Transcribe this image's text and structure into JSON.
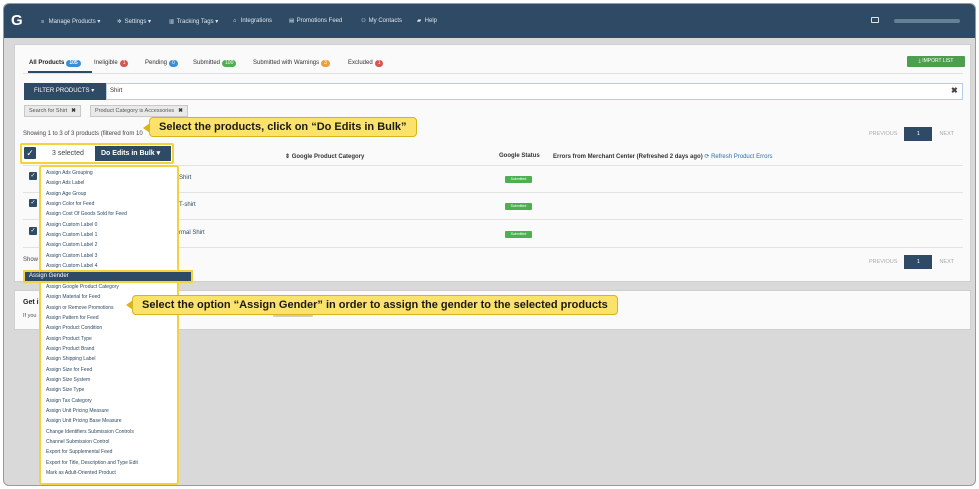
{
  "navbar": {
    "logo": "G",
    "items": [
      {
        "label": "Manage Products ▾",
        "icon": "list-icon"
      },
      {
        "label": "Settings ▾",
        "icon": "gear-icon"
      },
      {
        "label": "Tracking Tags ▾",
        "icon": "chart-icon"
      },
      {
        "label": "Integrations",
        "icon": "plug-icon"
      },
      {
        "label": "Promotions Feed",
        "icon": "feed-icon"
      },
      {
        "label": "My Contacts",
        "icon": "contacts-icon"
      },
      {
        "label": "Help",
        "icon": "help-icon"
      }
    ]
  },
  "tabs": [
    {
      "label": "All Products",
      "count": "105",
      "color": "#3a8fd9"
    },
    {
      "label": "Ineligible",
      "count": "1",
      "color": "#d9534f"
    },
    {
      "label": "Pending",
      "count": "0",
      "color": "#3a8fd9"
    },
    {
      "label": "Submitted",
      "count": "100",
      "color": "#4caf50"
    },
    {
      "label": "Submitted with Warnings",
      "count": "3",
      "color": "#e9a23b"
    },
    {
      "label": "Excluded",
      "count": "1",
      "color": "#d9534f"
    }
  ],
  "import_label": "IMPORT LIST",
  "filter": {
    "button_label": "FILTER PRODUCTS ▾",
    "search_value": "Shirt",
    "clear_symbol": "✖",
    "chips": [
      "Search for Shirt",
      "Product Category is Accessories"
    ]
  },
  "showing_text": "Showing 1 to 3 of 3 products (filtered from 10",
  "showing_bottom": "Show",
  "pager": {
    "previous": "PREVIOUS",
    "page": "1",
    "next": "NEXT"
  },
  "bulk": {
    "selected": "3 selected",
    "button": "Do Edits in Bulk ▾"
  },
  "table": {
    "headers": [
      "Google Product Category",
      "Google Status",
      "Errors from Merchant Center (Refreshed 2 days ago)"
    ],
    "refresh_link": "⟳ Refresh Product Errors",
    "rows": [
      {
        "title": "Shirt",
        "status": "Submitted"
      },
      {
        "title": "T-shirt",
        "status": "Submitted"
      },
      {
        "title": "rmal Shirt",
        "status": "Submitted"
      }
    ]
  },
  "get_section": {
    "title": "Get i",
    "subtitle": "If you"
  },
  "dropdown": {
    "items": [
      "Assign Ads Grouping",
      "Assign Ads Label",
      "Assign Age Group",
      "Assign Color for Feed",
      "Assign Cost Of Goods Sold for Feed",
      "Assign Custom Label 0",
      "Assign Custom Label 1",
      "Assign Custom Label 2",
      "Assign Custom Label 3",
      "Assign Custom Label 4",
      "Assign Gender",
      "Assign Google Product Category",
      "Assign Material for Feed",
      "Assign or Remove Promotions",
      "Assign Pattern for Feed",
      "Assign Product Condition",
      "Assign Product Type",
      "Assign Product Brand",
      "Assign Shipping Label",
      "Assign Size for Feed",
      "Assign Size System",
      "Assign Size Type",
      "Assign Tax Category",
      "Assign Unit Pricing Measure",
      "Assign Unit Pricing Base Measure",
      "Change Identifiers Submission Controls",
      "Channel Submission Control",
      "Export for Supplemental Feed",
      "Export for Title, Description and Type Edit",
      "Mark as Adult-Oriented Product"
    ]
  },
  "callouts": {
    "first": "Select the products, click on “Do Edits in Bulk”",
    "second": "Select the option “Assign Gender” in order to assign the gender to the selected products"
  }
}
